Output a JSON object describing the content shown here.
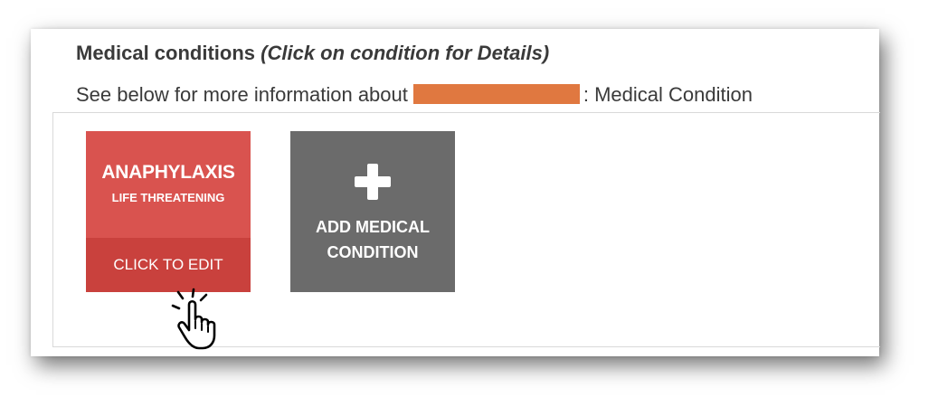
{
  "header": {
    "title": "Medical conditions ",
    "title_hint": "(Click on condition for Details)",
    "subtitle_prefix": "See below for more information about",
    "subtitle_suffix": ": Medical Condition",
    "redaction_color": "#e07840"
  },
  "conditions": [
    {
      "name": "ANAPHYLAXIS",
      "severity": "LIFE THREATENING",
      "action_label": "CLICK TO EDIT",
      "color": "#d9534f"
    }
  ],
  "add_card": {
    "label_line1": "ADD MEDICAL",
    "label_line2": "CONDITION",
    "icon": "plus-icon",
    "color": "#6b6b6b"
  },
  "cursor": {
    "icon": "hand-pointer-icon"
  }
}
